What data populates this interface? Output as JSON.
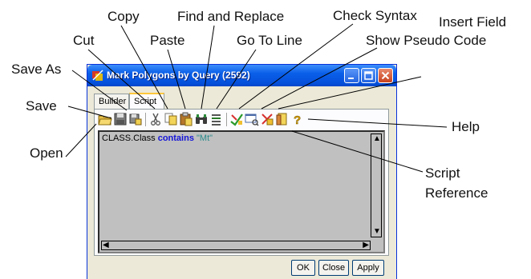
{
  "callouts": {
    "copy": "Copy",
    "find_replace": "Find and Replace",
    "check_syntax": "Check Syntax",
    "insert_field": "Insert Field",
    "cut": "Cut",
    "paste": "Paste",
    "go_to_line": "Go To Line",
    "show_pseudo_code": "Show Pseudo Code",
    "save_as": "Save As",
    "save": "Save",
    "open": "Open",
    "help": "Help",
    "script": "Script",
    "reference": "Reference"
  },
  "window": {
    "title": "Mark Polygons by Query (2592)",
    "tabs": [
      "Builder",
      "Script"
    ],
    "active_tab": "Script"
  },
  "editor": {
    "code_object": "CLASS.Class",
    "code_keyword": "contains",
    "code_string": "\"Mt\""
  },
  "buttons": {
    "ok": "OK",
    "close": "Close",
    "apply": "Apply"
  },
  "colors": {
    "titlebar": "#0550dc",
    "keyword": "#1414d8",
    "string": "#2a8a8a"
  }
}
